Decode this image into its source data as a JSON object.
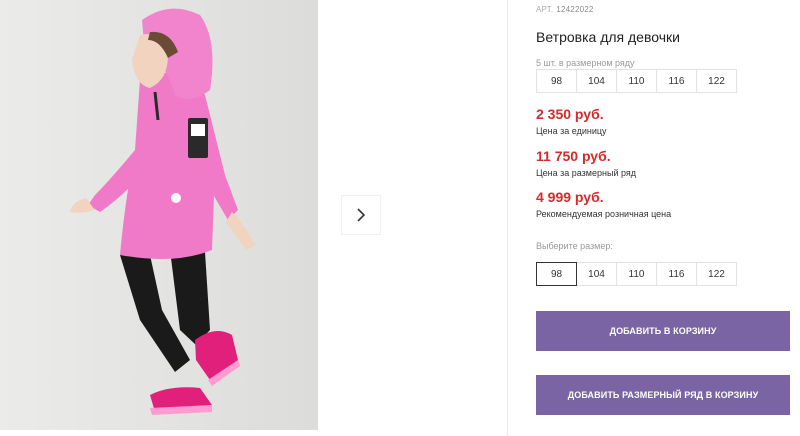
{
  "product": {
    "sku_label": "АРТ.",
    "sku": "12422022",
    "title": "Ветровка для девочки",
    "size_row_note": "5 шт. в размерном ряду",
    "size_row": [
      "98",
      "104",
      "110",
      "116",
      "122"
    ]
  },
  "prices": [
    {
      "value": "2 350 руб.",
      "label": "Цена за единицу"
    },
    {
      "value": "11 750 руб.",
      "label": "Цена за размерный ряд"
    },
    {
      "value": "4 999 руб.",
      "label": "Рекомендуемая розничная цена"
    }
  ],
  "size_picker": {
    "label": "Выберите размер:",
    "options": [
      "98",
      "104",
      "110",
      "116",
      "122"
    ],
    "selected": "98"
  },
  "buttons": {
    "add_to_cart": "ДОБАВИТЬ В КОРЗИНУ",
    "add_size_row": "ДОБАВИТЬ РАЗМЕРНЫЙ РЯД В КОРЗИНУ"
  },
  "colors": {
    "accent": "#7a64a4",
    "price": "#d42a2a",
    "jacket": "#f07ac8",
    "photo_bg": "#e4e4e2"
  },
  "icons": {
    "next": "chevron-right-icon"
  }
}
